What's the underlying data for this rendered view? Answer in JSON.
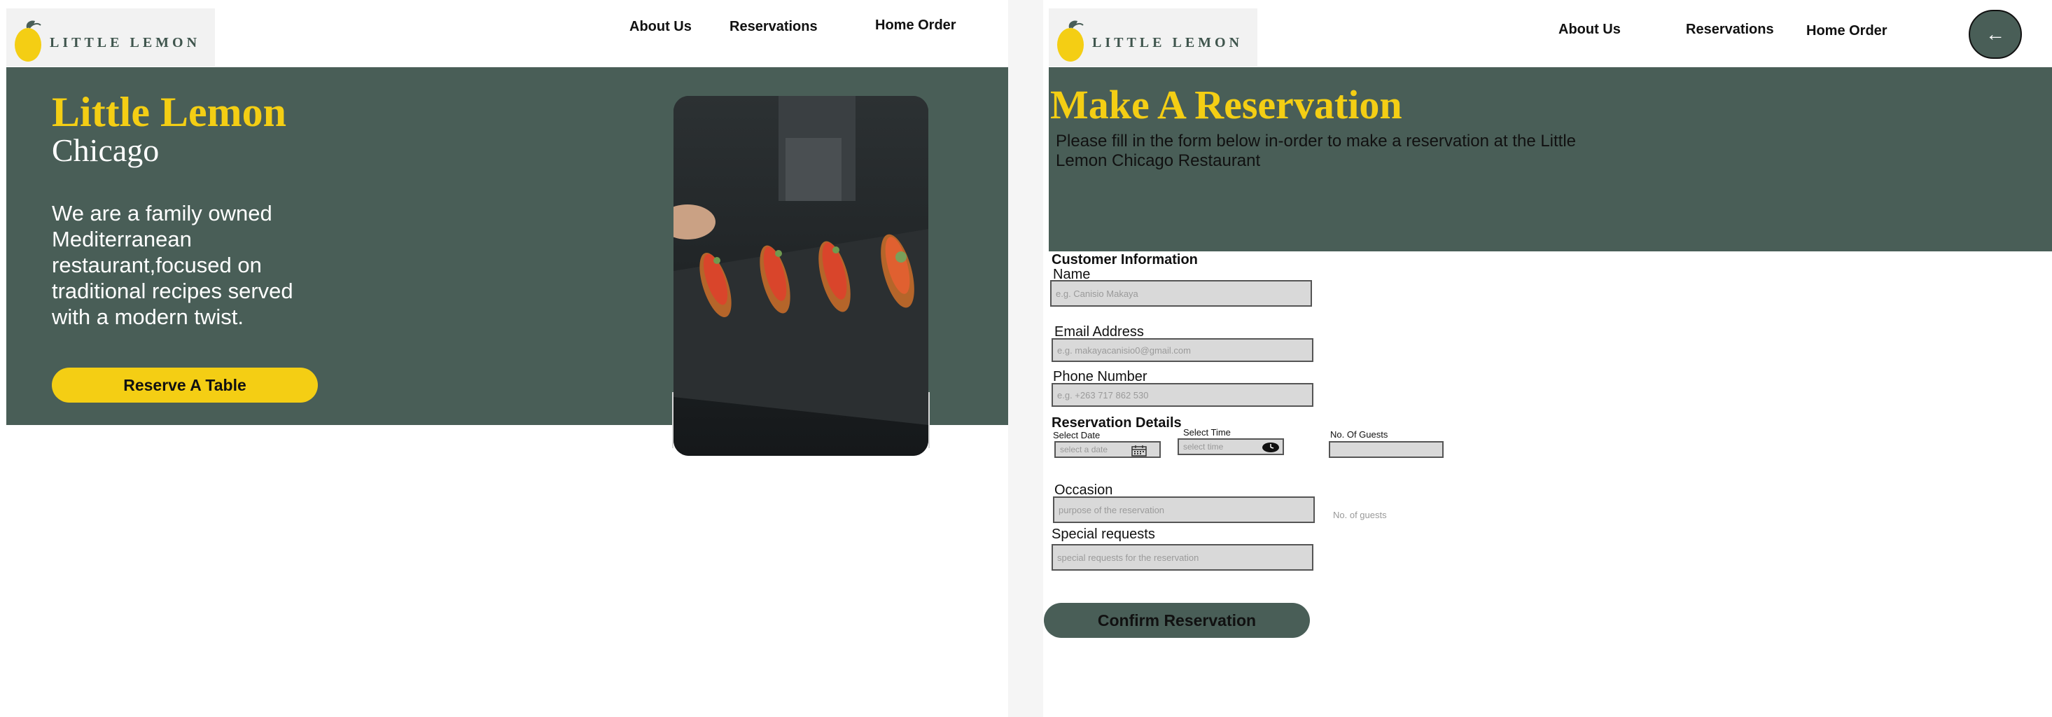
{
  "left_page": {
    "logo": {
      "text": "LITTLE LEMON",
      "icon": "lemon-icon"
    },
    "nav": {
      "about": "About Us",
      "reservations": "Reservations",
      "home_order": "Home Order"
    },
    "hero": {
      "title": "Little Lemon",
      "subtitle": "Chicago",
      "description": "We are a family owned Mediterranean restaurant,focused on traditional recipes served with a modern twist.",
      "cta": "Reserve A Table"
    },
    "image": {
      "subject": "plated bruschetta on slate held by waiter"
    }
  },
  "right_page": {
    "logo": {
      "text": "LITTLE LEMON",
      "icon": "lemon-icon"
    },
    "nav": {
      "about": "About Us",
      "reservations": "Reservations",
      "home_order": "Home Order"
    },
    "back_icon": "arrow-left-icon",
    "title": "Make A Reservation",
    "description": "Please fill in the form below in-order to make a reservation at the Little Lemon Chicago Restaurant",
    "customer_section": "Customer Information",
    "name_label": "Name",
    "name_placeholder": "e.g. Canisio Makaya",
    "email_label": "Email Address",
    "email_placeholder": "e.g. makayacanisio0@gmail.com",
    "phone_label": "Phone Number",
    "phone_placeholder": "e.g. +263 717 862 530",
    "reservation_section": "Reservation Details",
    "date_label": "Select Date",
    "date_placeholder": "select a date",
    "time_label": "Select Time",
    "time_placeholder": "select time",
    "guests_label": "No. Of Guests",
    "guests_hint": "No. of guests",
    "occasion_label": "Occasion",
    "occasion_placeholder": "purpose of the reservation",
    "requests_label": "Special requests",
    "requests_placeholder": "special requests for the reservation",
    "confirm": "Confirm Reservation"
  },
  "colors": {
    "brand_green": "#495e57",
    "brand_yellow": "#f4ce14",
    "field_grey": "#d9d9d9"
  }
}
